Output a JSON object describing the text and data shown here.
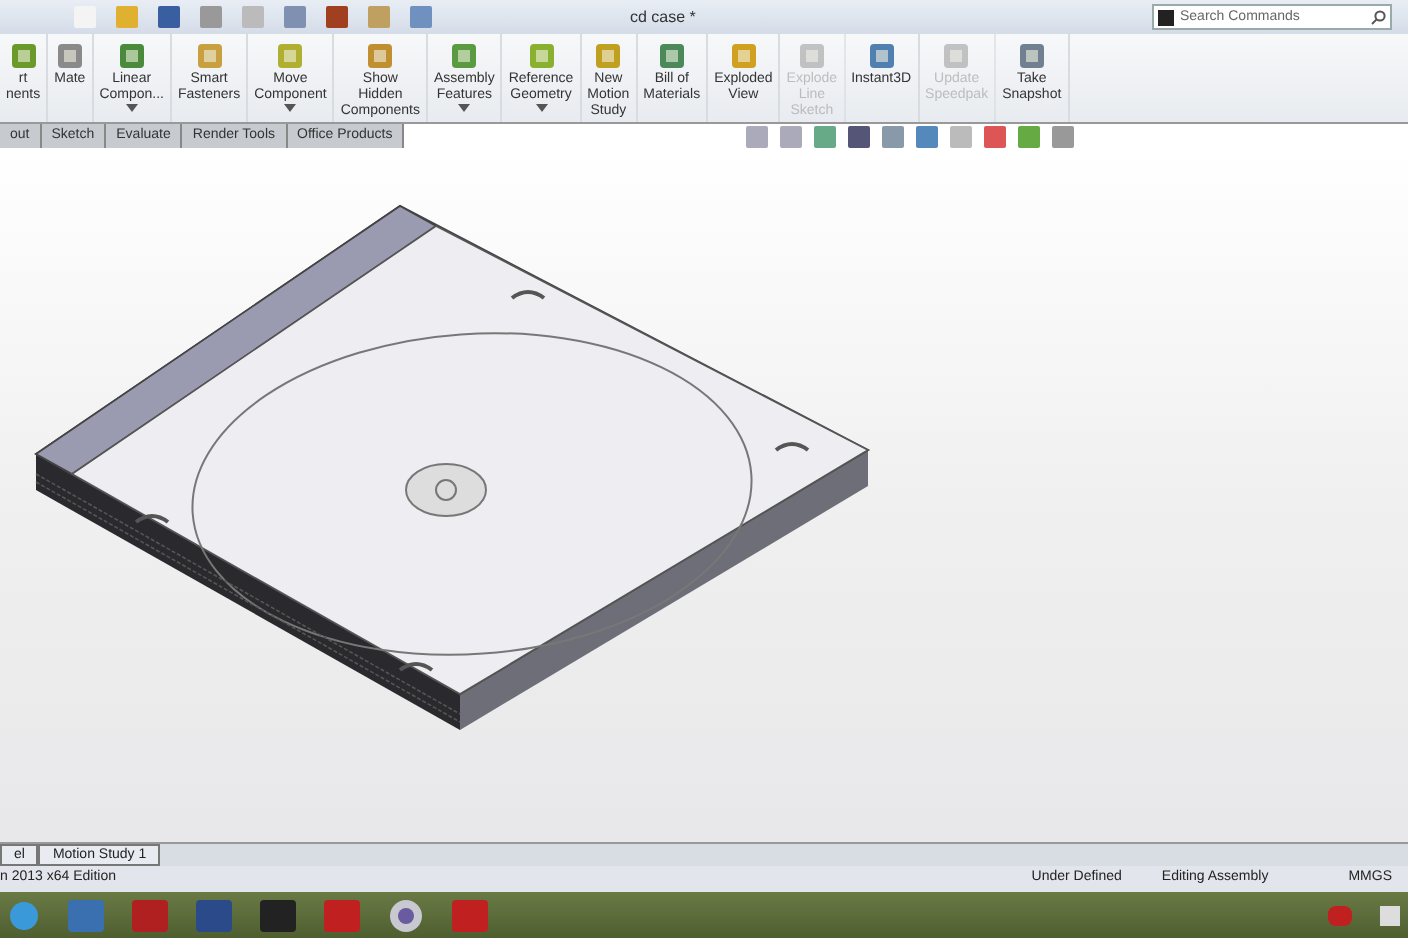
{
  "window": {
    "title": "cd case *"
  },
  "search": {
    "placeholder": "Search Commands"
  },
  "ribbon": [
    {
      "label": "rt\nnents",
      "disabled": false,
      "dropdown": false
    },
    {
      "label": "Mate",
      "disabled": false,
      "dropdown": false
    },
    {
      "label": "Linear\nCompon...",
      "disabled": false,
      "dropdown": true
    },
    {
      "label": "Smart\nFasteners",
      "disabled": false,
      "dropdown": false
    },
    {
      "label": "Move\nComponent",
      "disabled": false,
      "dropdown": true
    },
    {
      "label": "Show\nHidden\nComponents",
      "disabled": false,
      "dropdown": false
    },
    {
      "label": "Assembly\nFeatures",
      "disabled": false,
      "dropdown": true
    },
    {
      "label": "Reference\nGeometry",
      "disabled": false,
      "dropdown": true
    },
    {
      "label": "New\nMotion\nStudy",
      "disabled": false,
      "dropdown": false
    },
    {
      "label": "Bill of\nMaterials",
      "disabled": false,
      "dropdown": false
    },
    {
      "label": "Exploded\nView",
      "disabled": false,
      "dropdown": false
    },
    {
      "label": "Explode\nLine\nSketch",
      "disabled": true,
      "dropdown": false
    },
    {
      "label": "Instant3D",
      "disabled": false,
      "dropdown": false
    },
    {
      "label": "Update\nSpeedpak",
      "disabled": true,
      "dropdown": false
    },
    {
      "label": "Take\nSnapshot",
      "disabled": false,
      "dropdown": false
    }
  ],
  "tabs": [
    {
      "label": "out",
      "selected": false
    },
    {
      "label": "Sketch",
      "selected": false
    },
    {
      "label": "Evaluate",
      "selected": false
    },
    {
      "label": "Render Tools",
      "selected": false
    },
    {
      "label": "Office Products",
      "selected": false
    }
  ],
  "bottom_tabs": [
    {
      "label": "el",
      "selected": false
    },
    {
      "label": "Motion Study 1",
      "selected": false
    }
  ],
  "status_bar": {
    "edition": "n 2013 x64 Edition",
    "state": "Under Defined",
    "mode": "Editing Assembly",
    "units": "MMGS"
  }
}
